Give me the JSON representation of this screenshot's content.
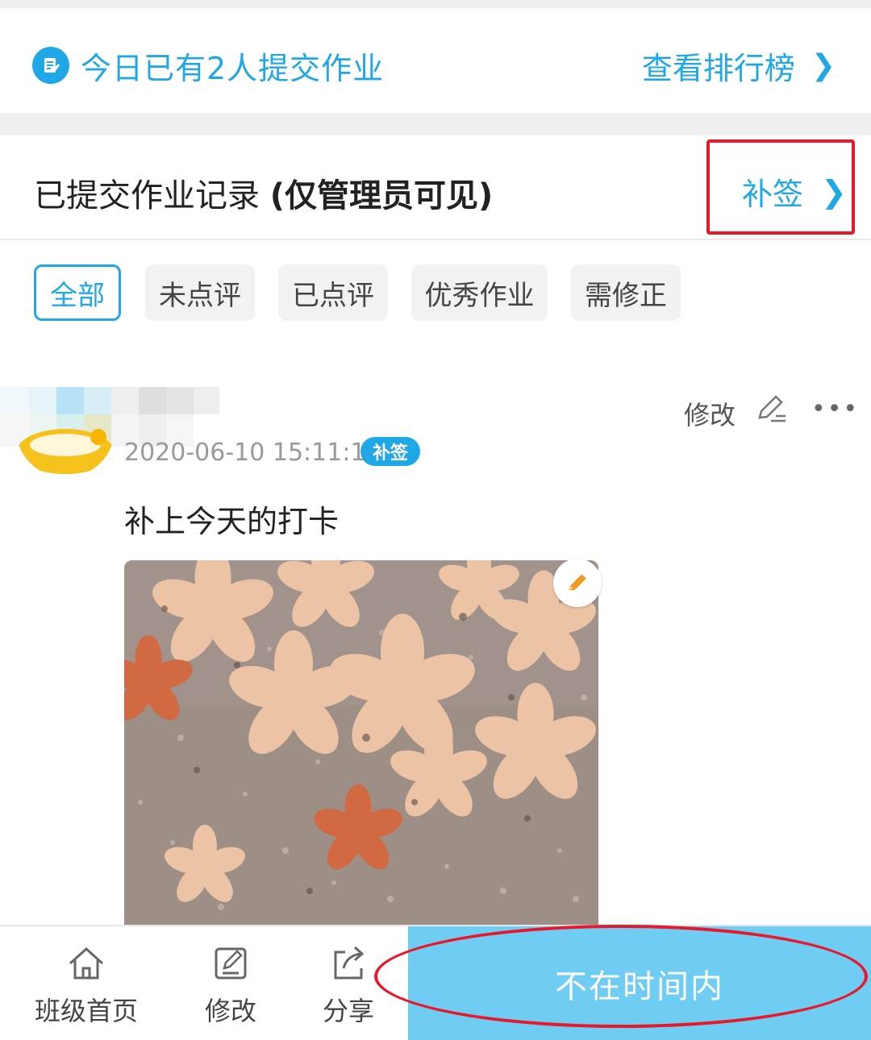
{
  "summary": {
    "submitted_today": "今日已有2人提交作业",
    "ranking_link": "查看排行榜",
    "icon": "note-icon",
    "accent": "#20a7e6"
  },
  "records": {
    "title_normal": "已提交作业记录 ",
    "title_bold": "(仅管理员可见)",
    "makeup_link": "补签"
  },
  "filters": [
    "全部",
    "未点评",
    "已点评",
    "优秀作业",
    "需修正"
  ],
  "filters_active": "全部",
  "post": {
    "edit_label": "修改",
    "timestamp": "2020-06-10 15:11:13",
    "tag": "补签",
    "content": "补上今天的打卡"
  },
  "bottom_nav": [
    {
      "label": "班级首页",
      "icon": "home-icon"
    },
    {
      "label": "修改",
      "icon": "edit-icon"
    },
    {
      "label": "分享",
      "icon": "share-icon"
    }
  ],
  "action_button": "不在时间内",
  "colors": {
    "highlight": "#e8182b",
    "action_bg": "#6fccf3"
  }
}
